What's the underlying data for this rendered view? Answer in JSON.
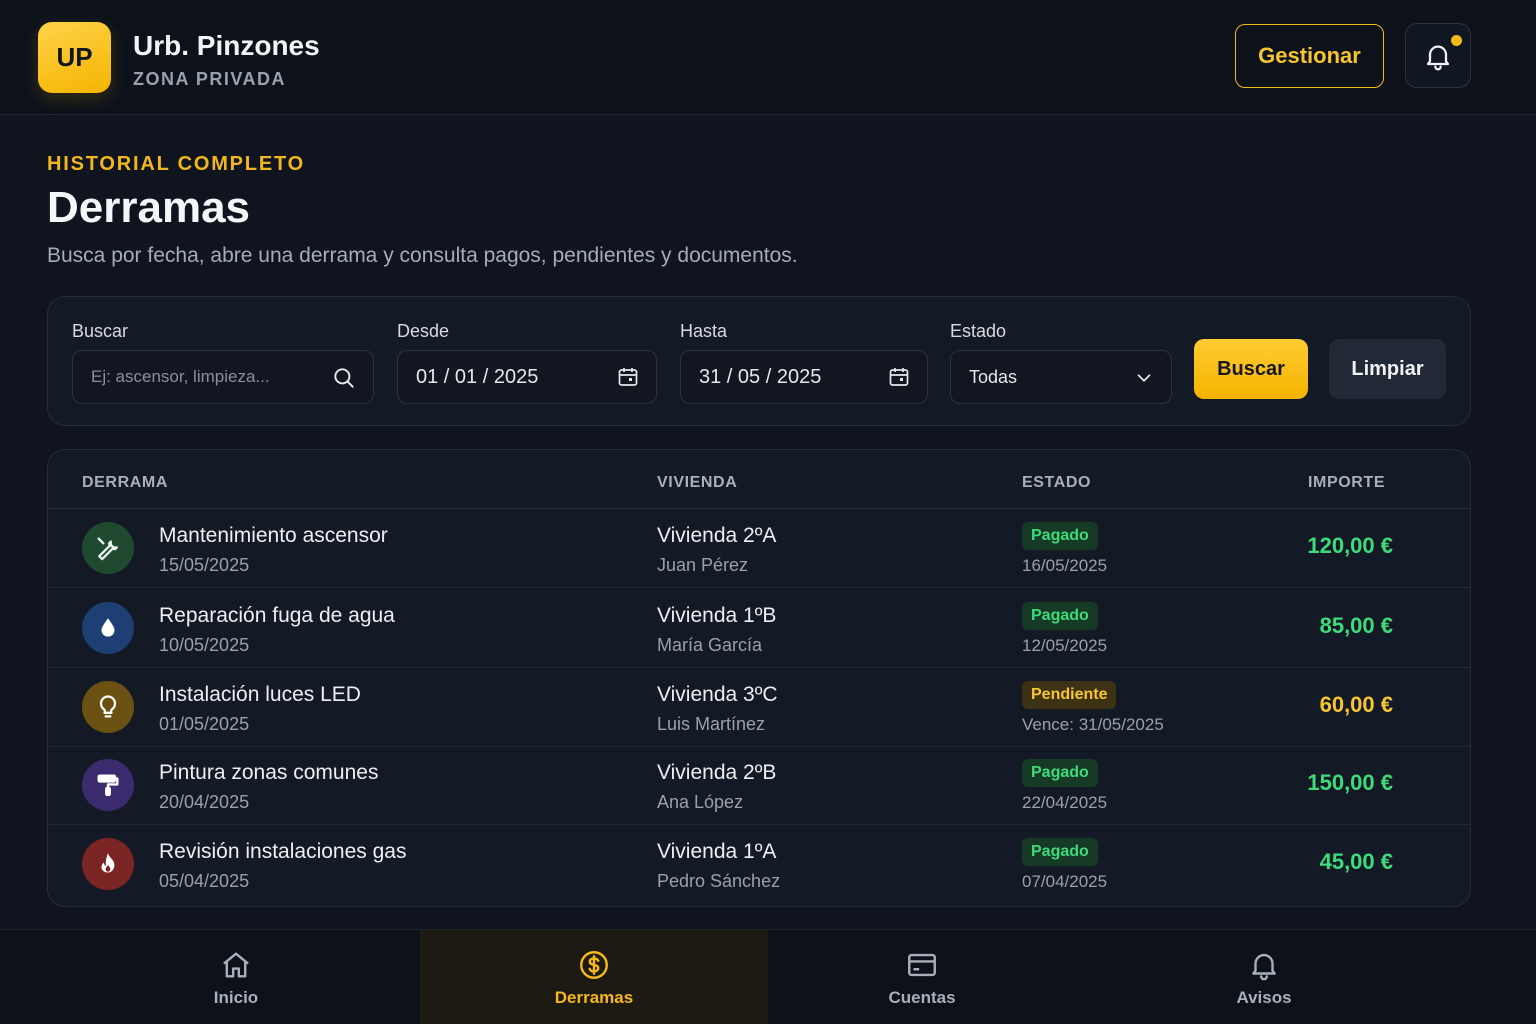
{
  "header": {
    "logo_text": "UP",
    "title": "Urb. Pinzones",
    "subtitle": "ZONA PRIVADA",
    "manage_label": "Gestionar",
    "notification_icon": "bell-icon"
  },
  "page": {
    "eyebrow": "HISTORIAL COMPLETO",
    "title": "Derramas",
    "description": "Busca por fecha, abre una derrama y consulta pagos, pendientes y documentos."
  },
  "filters": {
    "search_label": "Buscar",
    "search_placeholder": "Ej: ascensor, limpieza...",
    "from_label": "Desde",
    "from_value": "01 / 01 / 2025",
    "to_label": "Hasta",
    "to_value": "31 / 05 / 2025",
    "status_label": "Estado",
    "status_value": "Todas",
    "search_button": "Buscar",
    "clear_button": "Limpiar"
  },
  "table": {
    "columns": [
      "DERRAMA",
      "VIVIENDA",
      "ESTADO",
      "IMPORTE"
    ],
    "rows": [
      {
        "icon": "wrench-icon",
        "title": "Mantenimiento ascensor",
        "date": "15/05/2025",
        "vivienda": "Vivienda 2ºA",
        "owner": "Juan Pérez",
        "status": "Pagado",
        "status_date": "16/05/2025",
        "amount": "120,00 €",
        "kind": "paid",
        "icon_bg": "#1f4a2f",
        "icon_color": "#e9f5ec"
      },
      {
        "icon": "water-drop-icon",
        "title": "Reparación fuga de agua",
        "date": "10/05/2025",
        "vivienda": "Vivienda 1ºB",
        "owner": "María García",
        "status": "Pagado",
        "status_date": "12/05/2025",
        "amount": "85,00 €",
        "kind": "paid",
        "icon_bg": "#1d3f73",
        "icon_color": "#ffffff"
      },
      {
        "icon": "lightbulb-icon",
        "title": "Instalación luces LED",
        "date": "01/05/2025",
        "vivienda": "Vivienda 3ºC",
        "owner": "Luis Martínez",
        "status": "Pendiente",
        "status_date": "Vence: 31/05/2025",
        "amount": "60,00 €",
        "kind": "pending",
        "icon_bg": "#6b5213",
        "icon_color": "#ffffff"
      },
      {
        "icon": "paint-roller-icon",
        "title": "Pintura zonas comunes",
        "date": "20/04/2025",
        "vivienda": "Vivienda 2ºB",
        "owner": "Ana López",
        "status": "Pagado",
        "status_date": "22/04/2025",
        "amount": "150,00 €",
        "kind": "paid",
        "icon_bg": "#3b2a6e",
        "icon_color": "#ffffff"
      },
      {
        "icon": "flame-icon",
        "title": "Revisión instalaciones gas",
        "date": "05/04/2025",
        "vivienda": "Vivienda 1ºA",
        "owner": "Pedro Sánchez",
        "status": "Pagado",
        "status_date": "07/04/2025",
        "amount": "45,00 €",
        "kind": "paid",
        "icon_bg": "#7a2424",
        "icon_color": "#ffffff"
      }
    ]
  },
  "nav": {
    "items": [
      {
        "label": "Inicio",
        "icon": "home-icon"
      },
      {
        "label": "Derramas",
        "icon": "dollar-coin-icon",
        "active": true
      },
      {
        "label": "Cuentas",
        "icon": "card-icon"
      },
      {
        "label": "Avisos",
        "icon": "bell-icon"
      }
    ]
  },
  "colors": {
    "accent": "#f5b81c",
    "paid": "#3ddc7a",
    "pending": "#f7c531",
    "background": "#0f141e"
  }
}
